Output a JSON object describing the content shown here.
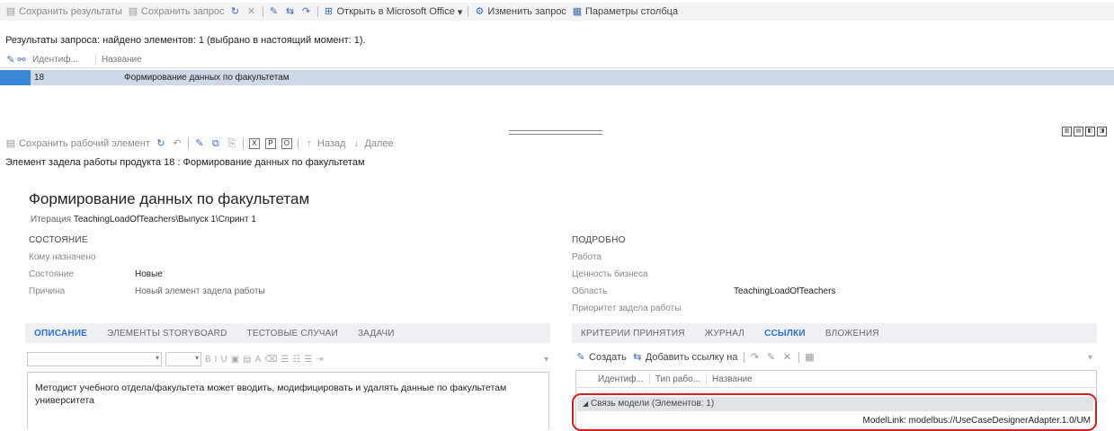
{
  "query_toolbar": {
    "save_results": "Сохранить результаты",
    "save_query": "Сохранить запрос",
    "open_office": "Открыть в Microsoft Office",
    "edit_query": "Изменить запрос",
    "column_options": "Параметры столбца"
  },
  "query_status": "Результаты запроса: найдено элементов: 1 (выбрано в настоящий момент: 1).",
  "results_grid": {
    "columns": [
      "Идентиф...",
      "Название"
    ],
    "rows": [
      {
        "id": "18",
        "title": "Формирование данных по факультетам"
      }
    ]
  },
  "work_item_toolbar": {
    "save": "Сохранить рабочий элемент",
    "back": "Назад",
    "next": "Далее"
  },
  "work_item_header": "Элемент задела работы продукта 18 : Формирование данных по факультетам",
  "work_item": {
    "title": "Формирование данных по факультетам",
    "iteration_label": "Итерация",
    "iteration_value": "TeachingLoadOfTeachers\\Выпуск 1\\Спринт 1",
    "state_section": "СОСТОЯНИЕ",
    "assigned_label": "Кому назначено",
    "state_label": "Состояние",
    "state_value": "Новые",
    "reason_label": "Причина",
    "reason_value": "Новый элемент задела работы",
    "details_section": "ПОДРОБНО",
    "effort_label": "Работа",
    "business_value_label": "Ценность бизнеса",
    "area_label": "Область",
    "area_value": "TeachingLoadOfTeachers",
    "priority_label": "Приоритет задела работы"
  },
  "left_tabs": [
    "ОПИСАНИЕ",
    "ЭЛЕМЕНТЫ STORYBOARD",
    "ТЕСТОВЫЕ СЛУЧАИ",
    "ЗАДАЧИ"
  ],
  "right_tabs": [
    "КРИТЕРИИ ПРИНЯТИЯ",
    "ЖУРНАЛ",
    "ССЫЛКИ",
    "ВЛОЖЕНИЯ"
  ],
  "description_text": "Методист учебного отдела/факультета может вводить, модифицировать и удалять данные по факультетам университета",
  "links_toolbar": {
    "create": "Создать",
    "add_link": "Добавить ссылку на"
  },
  "links_grid": {
    "columns": [
      "Идентиф...",
      "Тип рабо...",
      "Название"
    ],
    "group": "Связь модели (Элементов: 1)",
    "link_text": "ModelLink: modelbus://UseCaseDesignerAdapter.1.0/UM"
  },
  "colors": {
    "accent": "#2a6fd6",
    "selection": "#cdd8e8",
    "highlight": "#d62020"
  }
}
